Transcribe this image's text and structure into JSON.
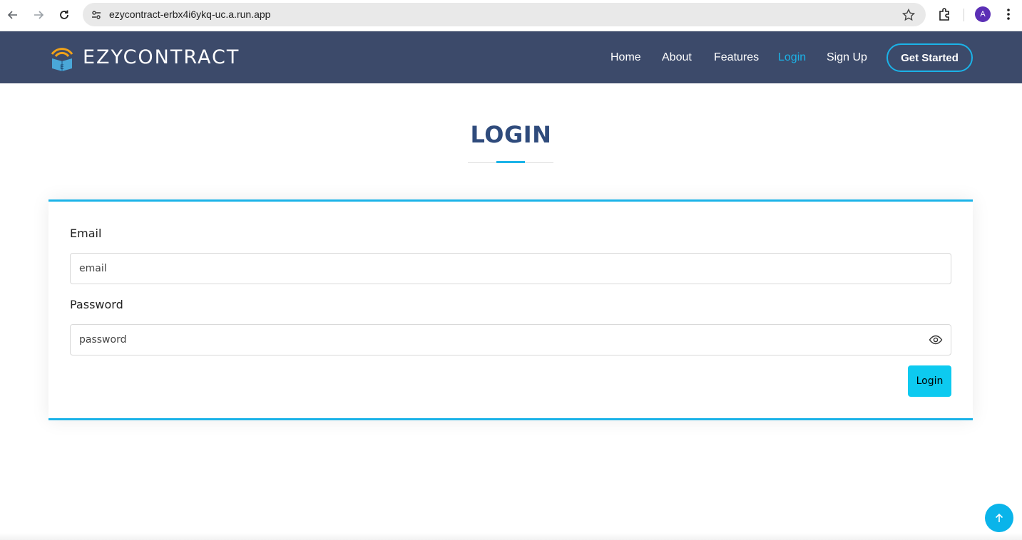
{
  "browser": {
    "url": "ezycontract-erbx4i6ykq-uc.a.run.app",
    "profile_initial": "A"
  },
  "header": {
    "logo_text": "EZYCONTRACT",
    "nav": [
      {
        "label": "Home"
      },
      {
        "label": "About"
      },
      {
        "label": "Features"
      },
      {
        "label": "Login",
        "active": true
      },
      {
        "label": "Sign Up"
      }
    ],
    "cta_label": "Get Started"
  },
  "page": {
    "title": "LOGIN"
  },
  "form": {
    "email_label": "Email",
    "email_placeholder": "email",
    "password_label": "Password",
    "password_placeholder": "password",
    "submit_label": "Login"
  },
  "colors": {
    "header_bg": "#3c4a6a",
    "accent": "#1bb3e8",
    "title": "#2f4b7c",
    "button": "#0dcaf0"
  },
  "icons": [
    "back-arrow-icon",
    "forward-arrow-icon",
    "reload-icon",
    "site-info-icon",
    "bookmark-star-icon",
    "extensions-icon",
    "menu-icon",
    "eye-icon",
    "arrow-up-icon"
  ]
}
